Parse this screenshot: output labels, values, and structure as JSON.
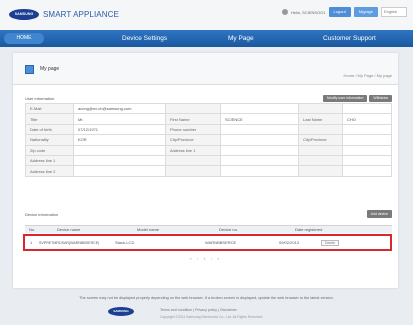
{
  "header": {
    "logo_text": "SAMSUNG",
    "brand": "SMART APPLIANCE",
    "user_text": "Hello, SCIENSOO1",
    "btn_logout": "Logout",
    "btn_mypage": "Mypage",
    "language": "English"
  },
  "nav": {
    "home": "HOME",
    "items": [
      "Device Settings",
      "My Page",
      "Customer Support"
    ]
  },
  "page": {
    "title": "My page",
    "breadcrumb": "Home / My Page / My page"
  },
  "user_info": {
    "section_label": "User information",
    "buttons": [
      "Modify user information",
      "Withdraw"
    ],
    "rows": [
      [
        "E-Mail",
        "acong@ex.ch@samsung.com",
        "",
        "",
        "",
        ""
      ],
      [
        "Title",
        "Mr.",
        "First Name",
        "SCIENCE",
        "Last Name",
        "CHO"
      ],
      [
        "Date of birth",
        "07/12/1971",
        "Phone number",
        "",
        "",
        ""
      ],
      [
        "Nationality",
        "KOR",
        "City/Province",
        "",
        "City/Province",
        ""
      ],
      [
        "Zip code",
        "",
        "Address line 1",
        "",
        "",
        ""
      ],
      [
        "Address line 1",
        "",
        "",
        "",
        "",
        ""
      ],
      [
        "Address line 2",
        "",
        "",
        "",
        "",
        ""
      ]
    ]
  },
  "devices": {
    "section_label": "Device information",
    "add_button": "Add device",
    "columns": [
      "No.",
      "Device name",
      "Model name",
      "Device no.",
      "Date registered"
    ],
    "rows": [
      {
        "no": "1",
        "name": "SVPRETMRDSAR(WARNBBSERCE)",
        "model": "Stack-LCD",
        "device_no": "WARNBBSERCE",
        "date": "09/02/2013",
        "action": "Delete"
      }
    ],
    "pager": "«  ‹  1  ›  »"
  },
  "footer": {
    "notice": "The screen may not be displayed properly depending on the web browser. If a broken screen is displayed, update the web browser to the latest version.",
    "logo_text": "SAMSUNG",
    "links": "Terms and condition  |  Privacy policy  |  Disclaimer",
    "copyright": "Copyright ©2011 Samsung Electronics Co., Ltd. All Rights Reserved."
  },
  "colors": {
    "nav_blue": "#1f5ea8",
    "highlight_red": "#d9272e",
    "brand_blue": "#2b5aa6"
  }
}
